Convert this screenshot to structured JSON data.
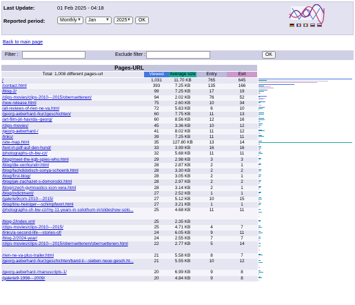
{
  "header": {
    "last_update_label": "Last Update:",
    "last_update_value": "01 Feb 2025 - 04:18",
    "reported_period_label": "Reported period:",
    "period_type": "Monthly",
    "month": "Jan",
    "year": "2025",
    "ok_label": "OK"
  },
  "back_link": "Back to main page",
  "filters": {
    "filter_label": "Filter :",
    "exclude_label": "Exclude filter :",
    "ok_label": "OK"
  },
  "table": {
    "title": "Pages-URL",
    "total_label": "Total: 1,008 different pages-url",
    "columns": [
      "Viewed",
      "Average size",
      "Entry",
      "Exit"
    ],
    "column_colors": {
      "Viewed": "#4477dd",
      "Average size": "#22aa99",
      "Entry": "#bbbbdd",
      "Exit": "#cc99cc"
    },
    "rows": [
      {
        "url": "/",
        "viewed": "1,031",
        "size": "11.70 KB",
        "entry": "765",
        "exit": "645"
      },
      {
        "url": "/contact.html",
        "viewed": "393",
        "size": "7.25 KB",
        "entry": "135",
        "exit": "166"
      },
      {
        "url": "/blog-2/",
        "viewed": "99",
        "size": "7.25 KB",
        "entry": "17",
        "exit": "19"
      },
      {
        "url": "/clips-movies/clips-2010---2015/oberruettenen/",
        "viewed": "94",
        "size": "2.02 KB",
        "entry": "76",
        "exit": "52"
      },
      {
        "url": "/new-release.html",
        "viewed": "75",
        "size": "2.60 KB",
        "entry": "10",
        "exit": "34"
      },
      {
        "url": "/all-reviews-of-rien-ne-va.html",
        "viewed": "72",
        "size": "5.63 KB",
        "entry": "6",
        "exit": "10"
      },
      {
        "url": "/georg-aeberhard-/kurzgeschichten/",
        "viewed": "60",
        "size": "7.75 KB",
        "entry": "11",
        "exit": "13"
      },
      {
        "url": "/art-film-jiri-havrda--georg/",
        "viewed": "60",
        "size": "8.56 KB",
        "entry": "12",
        "exit": "16"
      },
      {
        "url": "/clips-movies/",
        "viewed": "45",
        "size": "3.36 KB",
        "entry": "10",
        "exit": "12"
      },
      {
        "url": "/georg-aeberhard-/",
        "viewed": "41",
        "size": "8.02 KB",
        "entry": "11",
        "exit": "12"
      },
      {
        "url": "/links/",
        "viewed": "39",
        "size": "7.25 KB",
        "entry": "11",
        "exit": "11"
      },
      {
        "url": "/site-map.html",
        "viewed": "35",
        "size": "127.80 KB",
        "entry": "13",
        "exit": "14"
      },
      {
        "url": "/text-in-pdf-auf-den-hund/",
        "viewed": "33",
        "size": "3.99 KB",
        "entry": "16",
        "exit": "16"
      },
      {
        "url": "/photographs-ch-bw-cz/",
        "viewed": "32",
        "size": "5.68 KB",
        "entry": "11",
        "exit": "11"
      },
      {
        "url": "/blog/meet-the-kgb-spies-who.html",
        "viewed": "29",
        "size": "2.98 KB",
        "entry": "3",
        "exit": "3"
      },
      {
        "url": "/blog/die-verrkundrr.html",
        "viewed": "28",
        "size": "2.87 KB",
        "entry": "2",
        "exit": "1"
      },
      {
        "url": "/blog/fachdidotisch-sonya-schoenb.html",
        "viewed": "28",
        "size": "3.30 KB",
        "entry": "2",
        "exit": "2"
      },
      {
        "url": "/blog/first-blog/",
        "viewed": "28",
        "size": "3.05 KB",
        "entry": "2",
        "exit": "1"
      },
      {
        "url": "/blog/jak-zachazet-s-domorodci.html",
        "viewed": "28",
        "size": "2.97 KB",
        "entry": "2",
        "exit": "2"
      },
      {
        "url": "/blog/czech-gymnastics-icon-vera.html",
        "viewed": "28",
        "size": "3.14 KB",
        "entry": "2",
        "exit": "1"
      },
      {
        "url": "/blog/indictment/",
        "viewed": "27",
        "size": "2.52 KB",
        "entry": "1",
        "exit": "1"
      },
      {
        "url": "/galerie9com-2010---2015/",
        "viewed": "27",
        "size": "5.12 KB",
        "entry": "10",
        "exit": "15"
      },
      {
        "url": "/blog/tinu-heiniger---schimpfwort.html",
        "viewed": "27",
        "size": "3.21 KB",
        "entry": "1",
        "exit": "1"
      },
      {
        "url": "/photographs-ch-bw-cz/my-11-years-in-solothurn-in/slideshow-solo...",
        "viewed": "25",
        "size": "4.68 KB",
        "entry": "11",
        "exit": "11",
        "tall": true
      },
      {
        "url": "/blog-2/index.xml",
        "viewed": "25",
        "size": "2.35 KB",
        "entry": "",
        "exit": ""
      },
      {
        "url": "/clips-movies/clips-2010---2015/",
        "viewed": "25",
        "size": "4.71 KB",
        "entry": "4",
        "exit": "7"
      },
      {
        "url": "/links/a-second-life---stories-of/",
        "viewed": "24",
        "size": "6.05 KB",
        "entry": "9",
        "exit": "11"
      },
      {
        "url": "/blog-2/2024-year/",
        "viewed": "24",
        "size": "2.55 KB",
        "entry": "7",
        "exit": "7"
      },
      {
        "url": "/clips-movies/clips-2010---2015/oberruettenen/oberruettenen.html",
        "viewed": "22",
        "size": "2.77 KB",
        "entry": "5",
        "exit": "14",
        "tall": true
      },
      {
        "url": "/rien-ne-va-plus-trailer.html",
        "viewed": "21",
        "size": "5.58 KB",
        "entry": "8",
        "exit": "7"
      },
      {
        "url": "/georg-aeberhard-/kurzgeschichten/band-ii---sieben-neue-gesch.ht...",
        "viewed": "21",
        "size": "5.55 KB",
        "entry": "10",
        "exit": "12",
        "tall": true
      },
      {
        "url": "/georg-aeberhard-/manuscripts-1/",
        "viewed": "20",
        "size": "6.99 KB",
        "entry": "9",
        "exit": "8"
      },
      {
        "url": "/galerie9-1998---2009/",
        "viewed": "20",
        "size": "4.84 KB",
        "entry": "9",
        "exit": "8"
      }
    ]
  }
}
